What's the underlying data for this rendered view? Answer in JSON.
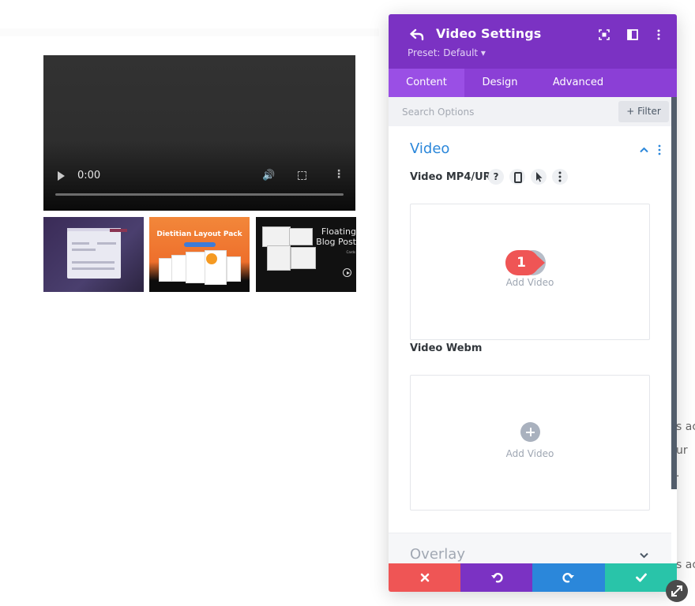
{
  "video_player": {
    "time": "0:00"
  },
  "thumbnails": [
    {
      "title": ""
    },
    {
      "title": "Dietitian Layout Pack"
    },
    {
      "title": "Floating Blog Post",
      "subtitle": "Cards"
    }
  ],
  "page_text": [
    "s ac",
    "ur",
    ".",
    "s ac"
  ],
  "settings": {
    "title": "Video Settings",
    "preset": "Preset: Default ▾",
    "tabs": [
      {
        "label": "Content",
        "active": true
      },
      {
        "label": "Design",
        "active": false
      },
      {
        "label": "Advanced",
        "active": false
      }
    ],
    "search": {
      "placeholder": "Search Options"
    },
    "filter_label": "+ Filter",
    "section": {
      "title": "Video",
      "fields": [
        {
          "label": "Video MP4/URL",
          "add_label": "Add Video"
        },
        {
          "label": "Video Webm",
          "add_label": "Add Video"
        }
      ]
    },
    "help_glyph": "?",
    "overlay_title": "Overlay",
    "step_badge": "1"
  },
  "colors": {
    "header": "#7b32c3",
    "tabs": "#8b3fd6",
    "section_title": "#2b87da",
    "cancel": "#ef5555",
    "undo": "#7b32c3",
    "redo": "#2b87da",
    "save": "#29c4a9",
    "badge": "#ef5555"
  }
}
